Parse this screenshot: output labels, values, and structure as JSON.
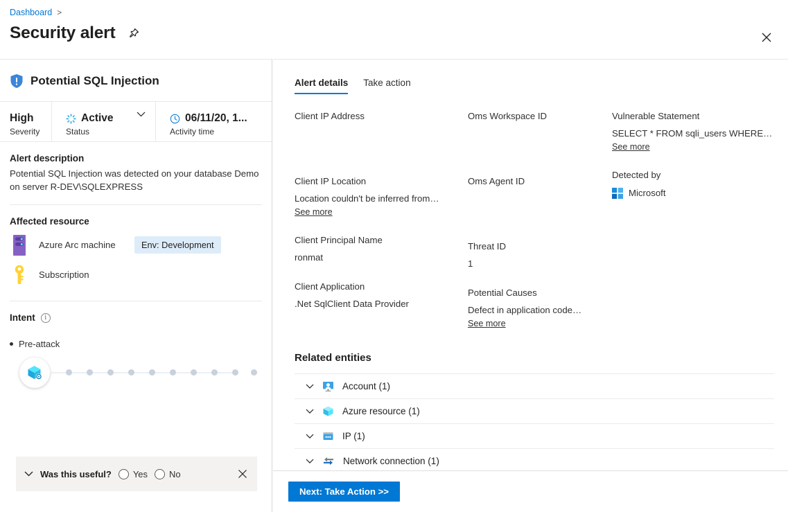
{
  "header": {
    "breadcrumb": "Dashboard",
    "breadcrumb_separator": ">",
    "title": "Security alert",
    "pin_icon": "pin-icon",
    "close_icon": "close-icon"
  },
  "left": {
    "alert_name": "Potential SQL Injection",
    "alert_icon": "shield-alert-icon",
    "status_bar": {
      "severity_value": "High",
      "severity_label": "Severity",
      "status_value": "Active",
      "status_label": "Status",
      "status_icon": "spinner-icon",
      "activity_time_value": "06/11/20, 1...",
      "activity_time_label": "Activity time",
      "activity_time_icon": "clock-icon",
      "chevron_icon": "chevron-down-icon"
    },
    "description": {
      "title": "Alert description",
      "text": "Potential SQL Injection was detected on your database Demo on server R-DEV\\SQLEXPRESS"
    },
    "affected_resource": {
      "title": "Affected resource",
      "items": [
        {
          "label": "Azure Arc machine",
          "icon": "server-icon",
          "tag": "Env: Development"
        },
        {
          "label": "Subscription",
          "icon": "key-icon",
          "tag": ""
        }
      ]
    },
    "intent": {
      "title": "Intent",
      "info_icon": "info-icon",
      "stage": "Pre-attack",
      "node_icon": "attack-cube-icon",
      "dot_count": 10
    },
    "feedback": {
      "chevron_icon": "chevron-down-icon",
      "question": "Was this useful?",
      "yes_label": "Yes",
      "no_label": "No",
      "close_icon": "close-icon"
    }
  },
  "right": {
    "tabs": [
      {
        "label": "Alert details",
        "active": true
      },
      {
        "label": "Take action",
        "active": false
      }
    ],
    "details_columns": [
      [
        {
          "key": "Client IP Address",
          "value": "",
          "see_more": false,
          "tall": true
        },
        {
          "key": "Client IP Location",
          "value": "Location couldn't be inferred from…",
          "see_more": true,
          "see_more_label": "See more",
          "tall": false
        },
        {
          "key": "Client Principal Name",
          "value": "ronmat",
          "see_more": false,
          "tall": false
        },
        {
          "key": "Client Application",
          "value": ".Net SqlClient Data Provider",
          "see_more": false,
          "tall": false
        }
      ],
      [
        {
          "key": "Oms Workspace ID",
          "value": "",
          "see_more": false,
          "tall": true
        },
        {
          "key": "Oms Agent ID",
          "value": "",
          "see_more": false,
          "tall": true
        },
        {
          "key": "Threat ID",
          "value": "1",
          "see_more": false,
          "tall": false
        },
        {
          "key": "Potential Causes",
          "value": "Defect in application code…",
          "see_more": true,
          "see_more_label": "See more",
          "tall": false
        }
      ],
      [
        {
          "key": "Vulnerable Statement",
          "value": "SELECT * FROM sqli_users WHERE…",
          "see_more": true,
          "see_more_label": "See more",
          "tall": false
        },
        {
          "key": "Detected by",
          "value": "Microsoft",
          "icon": "microsoft-logo-icon",
          "see_more": false,
          "tall": false
        }
      ]
    ],
    "related_entities": {
      "title": "Related entities",
      "rows": [
        {
          "label": "Account (1)",
          "icon": "account-monitor-icon",
          "chevron": "chevron-down-icon"
        },
        {
          "label": "Azure resource (1)",
          "icon": "azure-cube-icon",
          "chevron": "chevron-down-icon"
        },
        {
          "label": "IP (1)",
          "icon": "ip-window-icon",
          "chevron": "chevron-down-icon"
        },
        {
          "label": "Network connection (1)",
          "icon": "network-arrows-icon",
          "chevron": "chevron-down-icon"
        }
      ]
    },
    "footer": {
      "next_button": "Next: Take Action >>"
    }
  },
  "colors": {
    "accent": "#0078d4",
    "link": "#0078d4",
    "tag_bg": "#deecf9",
    "shield": "#3b86d8",
    "server": "#8661c5",
    "key": "#ffd233"
  }
}
